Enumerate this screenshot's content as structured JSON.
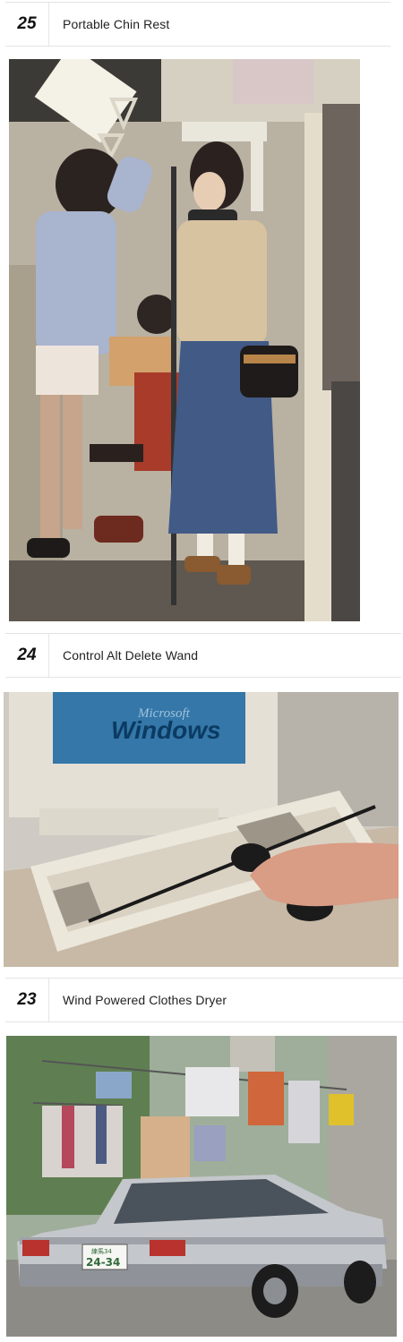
{
  "entries": [
    {
      "number": "25",
      "title": "Portable Chin Rest"
    },
    {
      "number": "24",
      "title": "Control Alt Delete Wand"
    },
    {
      "number": "23",
      "title": "Wind Powered Clothes Dryer"
    }
  ],
  "photo_text": {
    "monitor_brand": "Microsoft",
    "monitor_word": "Windows",
    "plate_small": "練馬34",
    "plate_large": "24-34"
  }
}
